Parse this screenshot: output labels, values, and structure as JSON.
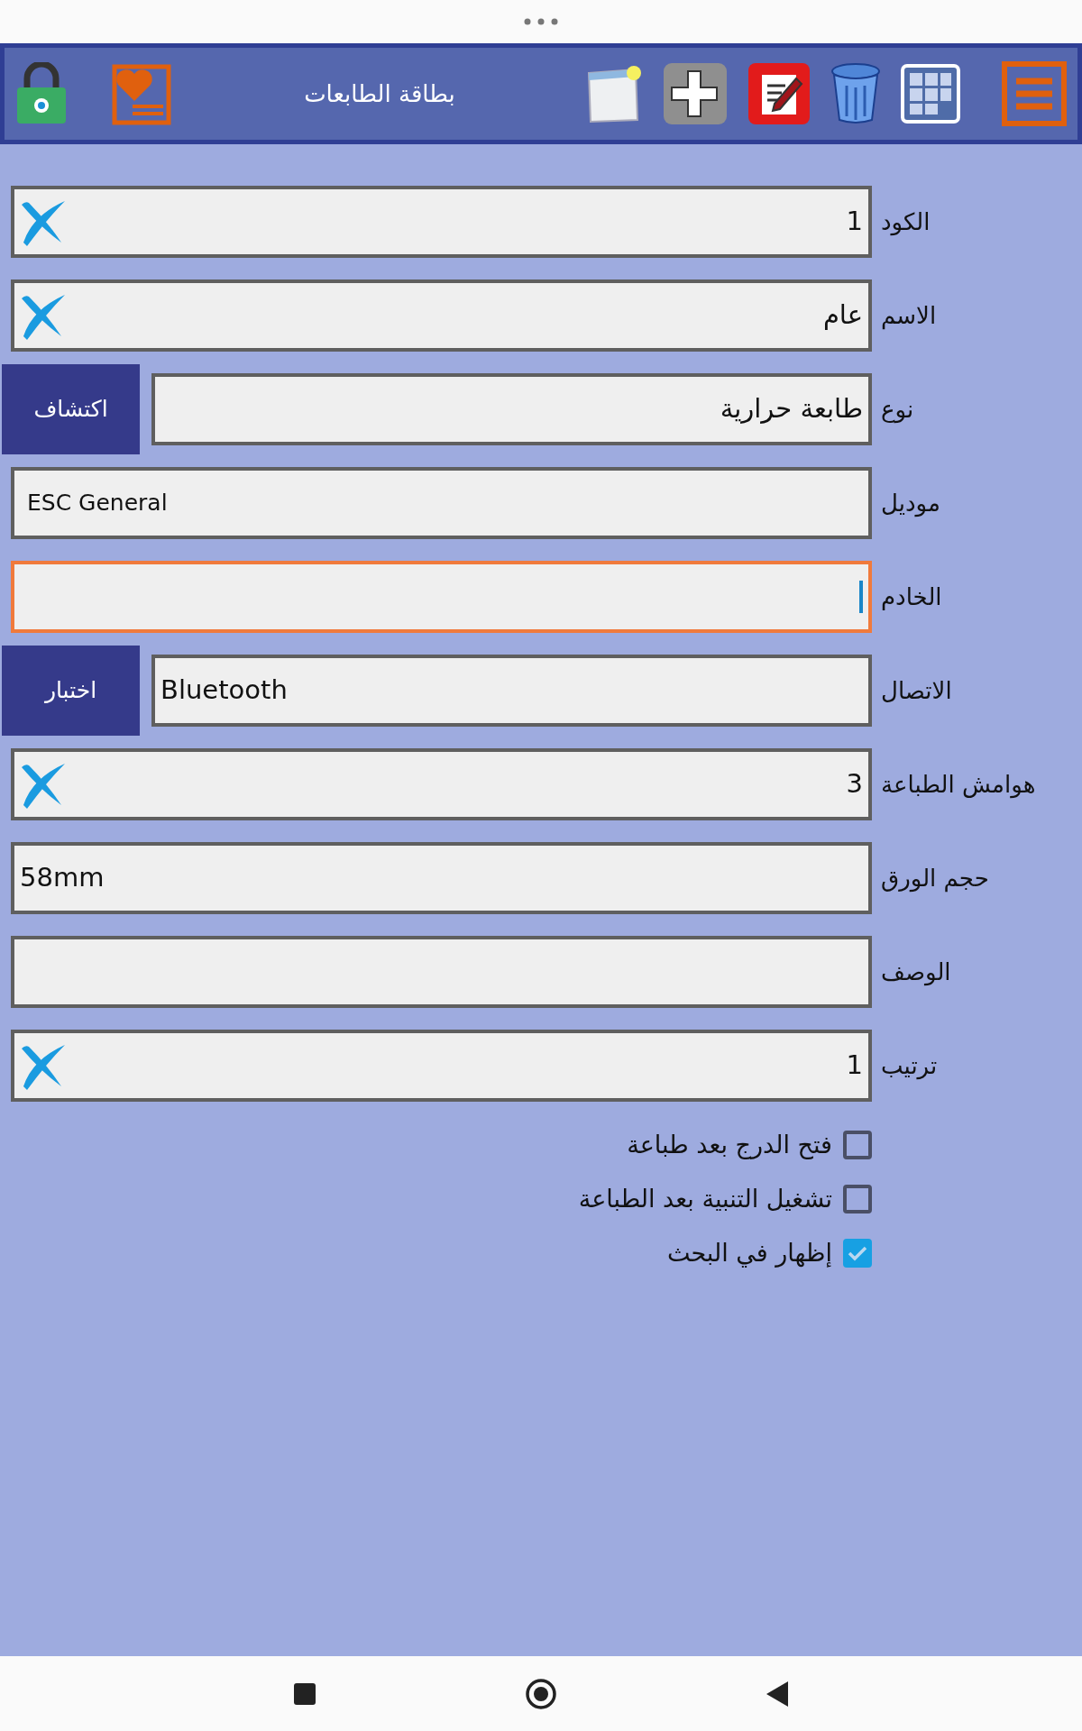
{
  "toolbar": {
    "title": "بطاقة الطابعات"
  },
  "fields": [
    {
      "label": "الكود",
      "value": "1",
      "kind": "clear",
      "focused": false
    },
    {
      "label": "الاسم",
      "value": "عام",
      "kind": "clear",
      "focused": false
    },
    {
      "label": "نوع",
      "value": "طابعة حرارية",
      "kind": "button",
      "button": "اكتشاف",
      "focused": false
    },
    {
      "label": "موديل",
      "value": "ESC General",
      "kind": "small",
      "focused": false
    },
    {
      "label": "الخادم",
      "kind": "plain",
      "focused": true
    },
    {
      "label": "الاتصال",
      "value": "Bluetooth",
      "kind": "button",
      "button": "اختبار",
      "focused": false
    },
    {
      "label": "هوامش الطباعة",
      "value": "3",
      "kind": "clear",
      "focused": false
    },
    {
      "label": "حجم الورق",
      "value": "58mm",
      "kind": "plain",
      "focused": false
    },
    {
      "label": "الوصف",
      "kind": "plain",
      "focused": false
    },
    {
      "label": "ترتيب",
      "value": "1",
      "kind": "clear",
      "focused": false
    }
  ],
  "checkboxes": [
    {
      "label": "فتح الدرج بعد طباعة",
      "checked": false
    },
    {
      "label": "تشغيل التنبية بعد الطباعة",
      "checked": false
    },
    {
      "label": "إظهار في البحث",
      "checked": true
    }
  ]
}
